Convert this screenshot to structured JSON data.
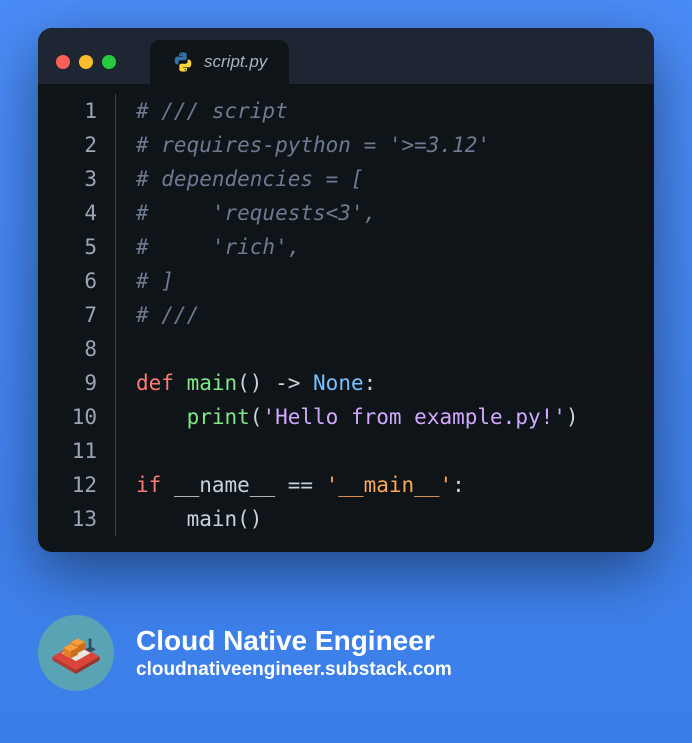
{
  "tab": {
    "filename": "script.py"
  },
  "code": {
    "lines": [
      {
        "n": "1",
        "tokens": [
          {
            "t": "# /// script",
            "c": "c-cmt"
          }
        ]
      },
      {
        "n": "2",
        "tokens": [
          {
            "t": "# requires-python = '>=3.12'",
            "c": "c-cmt"
          }
        ]
      },
      {
        "n": "3",
        "tokens": [
          {
            "t": "# dependencies = [",
            "c": "c-cmt"
          }
        ]
      },
      {
        "n": "4",
        "tokens": [
          {
            "t": "#     'requests<3',",
            "c": "c-cmt"
          }
        ]
      },
      {
        "n": "5",
        "tokens": [
          {
            "t": "#     'rich',",
            "c": "c-cmt"
          }
        ]
      },
      {
        "n": "6",
        "tokens": [
          {
            "t": "# ]",
            "c": "c-cmt"
          }
        ]
      },
      {
        "n": "7",
        "tokens": [
          {
            "t": "# ///",
            "c": "c-cmt"
          }
        ]
      },
      {
        "n": "8",
        "tokens": []
      },
      {
        "n": "9",
        "tokens": [
          {
            "t": "def ",
            "c": "c-kw"
          },
          {
            "t": "main",
            "c": "c-fn"
          },
          {
            "t": "()",
            "c": "c-op"
          },
          {
            "t": " -> ",
            "c": "c-op"
          },
          {
            "t": "None",
            "c": "c-type"
          },
          {
            "t": ":",
            "c": "c-op"
          }
        ]
      },
      {
        "n": "10",
        "tokens": [
          {
            "t": "    ",
            "c": "c-op"
          },
          {
            "t": "print",
            "c": "c-builtin"
          },
          {
            "t": "(",
            "c": "c-op"
          },
          {
            "t": "'Hello from example.py!'",
            "c": "c-str"
          },
          {
            "t": ")",
            "c": "c-op"
          }
        ]
      },
      {
        "n": "11",
        "tokens": []
      },
      {
        "n": "12",
        "tokens": [
          {
            "t": "if ",
            "c": "c-kw"
          },
          {
            "t": "__name__",
            "c": "c-id"
          },
          {
            "t": " == ",
            "c": "c-op"
          },
          {
            "t": "'__main__'",
            "c": "c-dunder"
          },
          {
            "t": ":",
            "c": "c-op"
          }
        ]
      },
      {
        "n": "13",
        "tokens": [
          {
            "t": "    main()",
            "c": "c-id"
          }
        ]
      }
    ]
  },
  "footer": {
    "title": "Cloud Native Engineer",
    "subtitle": "cloudnativeengineer.substack.com"
  }
}
